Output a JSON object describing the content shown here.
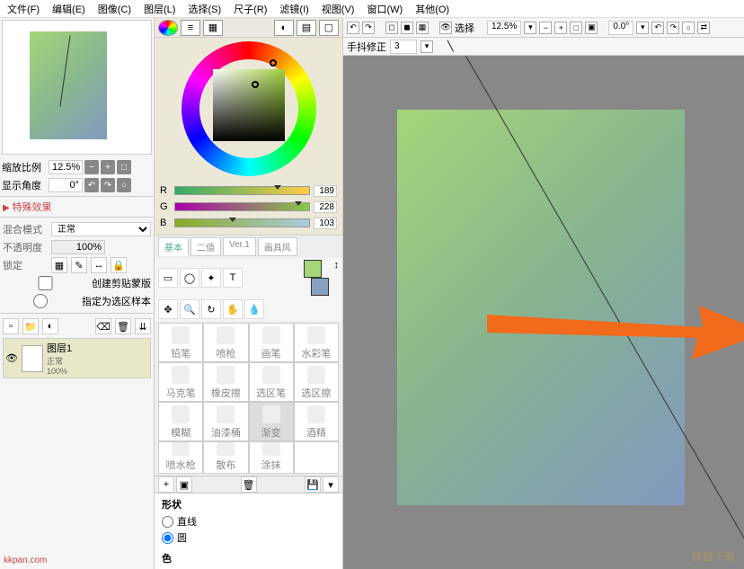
{
  "menu": {
    "file": "文件(F)",
    "edit": "编辑(E)",
    "image": "图像(C)",
    "layer": "图层(L)",
    "select": "选择(S)",
    "ruler": "尺子(R)",
    "filter": "滤镜(I)",
    "view": "视图(V)",
    "window": "窗口(W)",
    "other": "其他(O)"
  },
  "nav": {
    "zoom_lbl": "缩放比例",
    "zoom_val": "12.5%",
    "angle_lbl": "显示角度",
    "angle_val": "0°",
    "plus": "+",
    "minus": "−",
    "sq": "□",
    "rot_l": "↶",
    "rot_r": "↷",
    "reset": "○"
  },
  "fx": {
    "title": "特殊效果",
    "blend_lbl": "混合模式",
    "blend_val": "正常",
    "opacity_lbl": "不透明度",
    "opacity_val": "100%",
    "lock_lbl": "锁定",
    "clip_lbl": "创建剪贴蒙版",
    "sample_lbl": "指定为选区样本"
  },
  "layer": {
    "name": "图层1",
    "mode": "正常",
    "opacity": "100%"
  },
  "color": {
    "r_label": "R",
    "r_val": "189",
    "g_label": "G",
    "g_val": "228",
    "b_label": "B",
    "b_val": "103"
  },
  "tooltabs": {
    "t1": "基本",
    "t2": "二值",
    "t3": "Ver.1",
    "t4": "画具风"
  },
  "brushes": {
    "b1": "铅笔",
    "b2": "喷枪",
    "b3": "画笔",
    "b4": "水彩笔",
    "b5": "马克笔",
    "b6": "橡皮擦",
    "b7": "选区笔",
    "b8": "选区擦",
    "b9": "模糊",
    "b10": "油漆桶",
    "b11": "渐变",
    "b12": "酒精",
    "b13": "喷水枪",
    "b14": "散布",
    "b15": "涂抹"
  },
  "shape": {
    "title": "形状",
    "line": "直线",
    "circle": "圆",
    "se": "色"
  },
  "canvas": {
    "select_lbl": "选择",
    "zoom": "12.5%",
    "angle": "0.0°",
    "stab_lbl": "手抖修正",
    "stab_val": "3"
  },
  "watermark": "kkpan.com",
  "watermark2": "快盘下载"
}
